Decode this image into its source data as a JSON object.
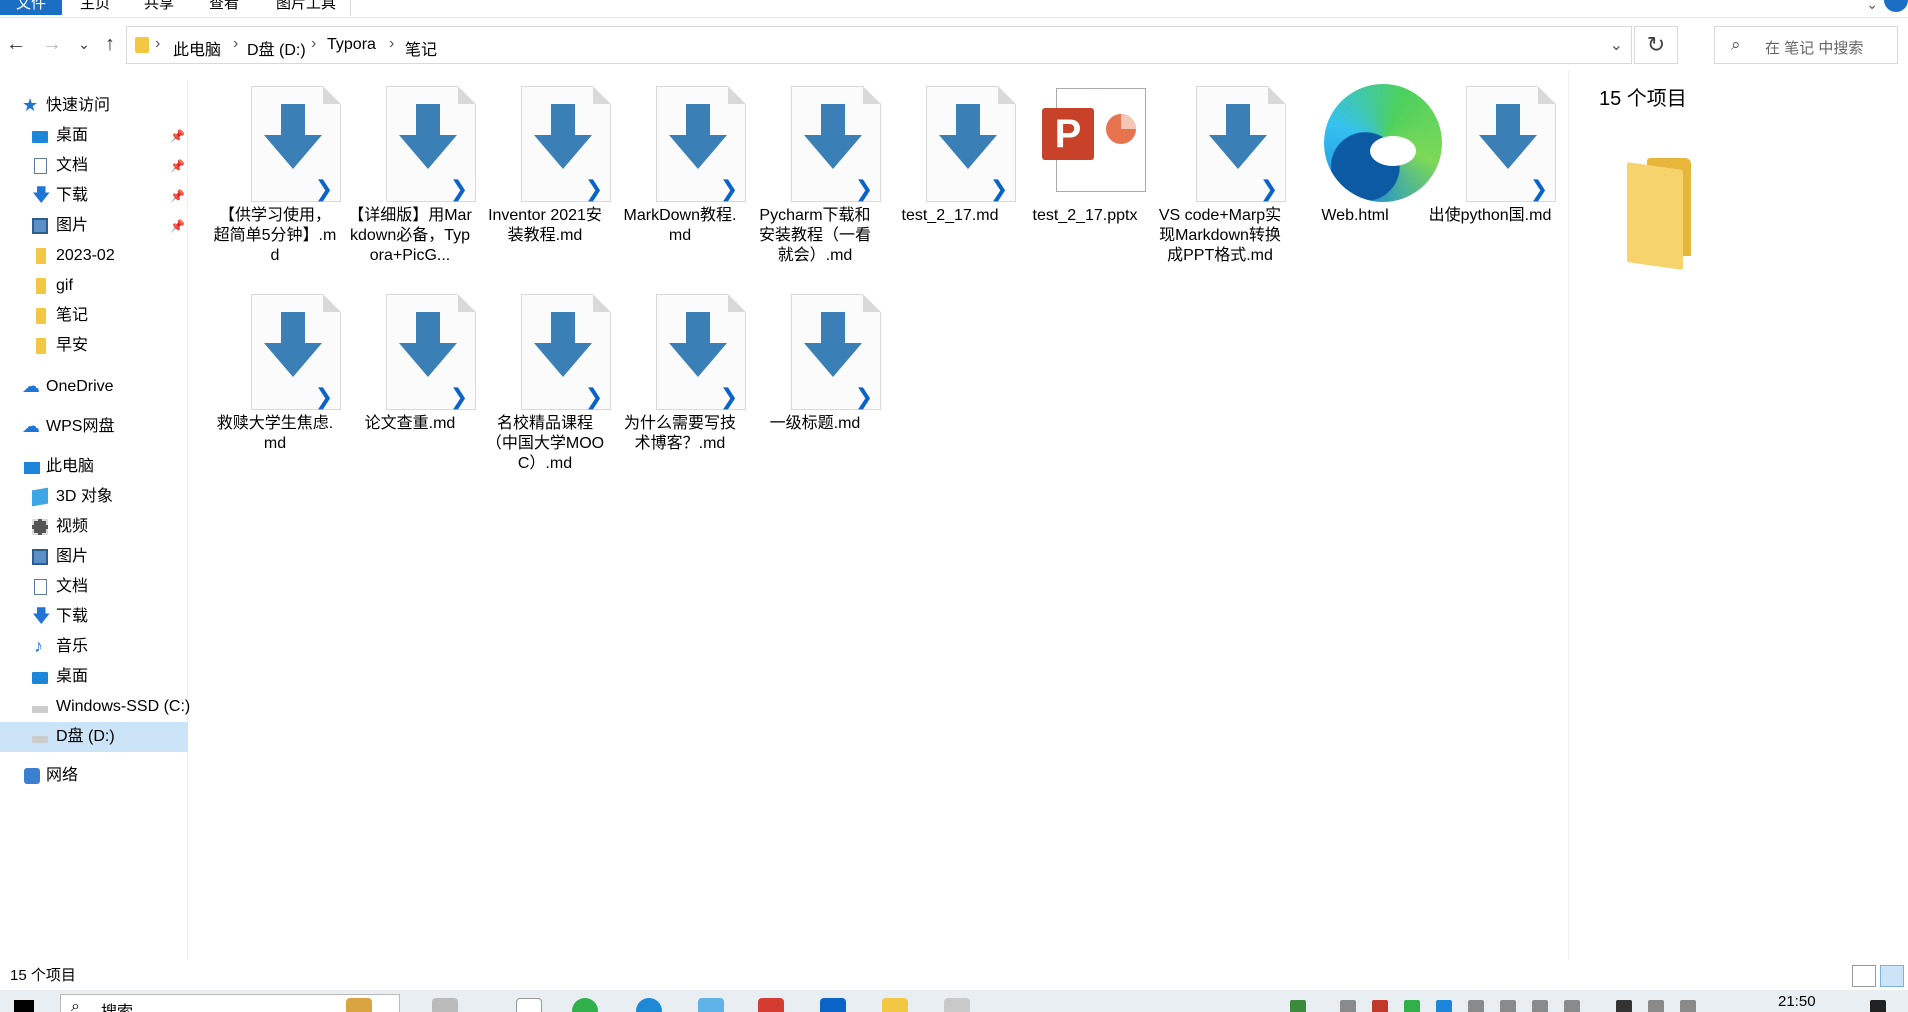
{
  "ribbon": {
    "tabs": [
      "文件",
      "主页",
      "共享",
      "查看",
      "图片工具"
    ]
  },
  "address": {
    "crumbs": [
      "此电脑",
      "D盘 (D:)",
      "Typora",
      "笔记"
    ],
    "search_placeholder": "在 笔记 中搜索"
  },
  "sidebar": {
    "quick_access": "快速访问",
    "quick_items": [
      "桌面",
      "文档",
      "下载",
      "图片",
      "2023-02",
      "gif",
      "笔记",
      "早安"
    ],
    "onedrive": "OneDrive",
    "wps": "WPS网盘",
    "this_pc": "此电脑",
    "pc_items": [
      "3D 对象",
      "视频",
      "图片",
      "文档",
      "下载",
      "音乐",
      "桌面",
      "Windows-SSD (C:)",
      "D盘 (D:)"
    ],
    "network": "网络"
  },
  "files": [
    "【供学习使用，超简单5分钟】.md",
    "【详细版】用Markdown必备，Typora+PicG...",
    "Inventor 2021安装教程.md",
    "MarkDown教程.md",
    "Pycharm下载和安装教程（一看就会）.md",
    "test_2_17.md",
    "test_2_17.pptx",
    "VS code+Marp实现Markdown转换成PPT格式.md",
    "Web.html",
    "出使python国.md",
    "救赎大学生焦虑.md",
    "论文查重.md",
    "名校精品课程（中国大学MOOC）.md",
    "为什么需要写技术博客？.md",
    "一级标题.md"
  ],
  "preview": {
    "count_label": "15 个项目"
  },
  "status": {
    "count_label": "15 个项目"
  },
  "taskbar": {
    "search_label": "搜索",
    "time": "21:50"
  },
  "colors": {
    "accent": "#1a6fc4",
    "selection": "#cce4f7",
    "folder": "#f2c744",
    "md_arrow": "#3a7fb5"
  }
}
